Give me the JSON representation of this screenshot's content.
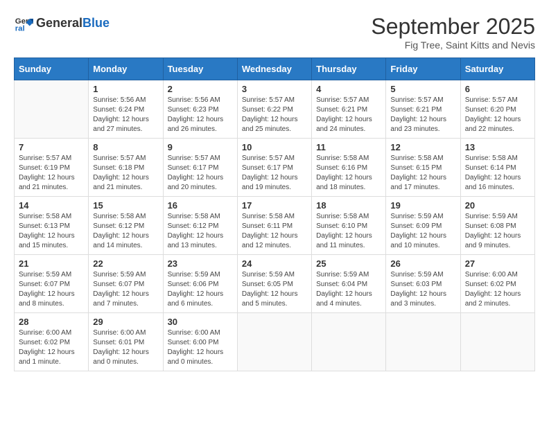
{
  "header": {
    "logo_general": "General",
    "logo_blue": "Blue",
    "month_title": "September 2025",
    "subtitle": "Fig Tree, Saint Kitts and Nevis"
  },
  "weekdays": [
    "Sunday",
    "Monday",
    "Tuesday",
    "Wednesday",
    "Thursday",
    "Friday",
    "Saturday"
  ],
  "weeks": [
    [
      {
        "day": "",
        "info": ""
      },
      {
        "day": "1",
        "info": "Sunrise: 5:56 AM\nSunset: 6:24 PM\nDaylight: 12 hours\nand 27 minutes."
      },
      {
        "day": "2",
        "info": "Sunrise: 5:56 AM\nSunset: 6:23 PM\nDaylight: 12 hours\nand 26 minutes."
      },
      {
        "day": "3",
        "info": "Sunrise: 5:57 AM\nSunset: 6:22 PM\nDaylight: 12 hours\nand 25 minutes."
      },
      {
        "day": "4",
        "info": "Sunrise: 5:57 AM\nSunset: 6:21 PM\nDaylight: 12 hours\nand 24 minutes."
      },
      {
        "day": "5",
        "info": "Sunrise: 5:57 AM\nSunset: 6:21 PM\nDaylight: 12 hours\nand 23 minutes."
      },
      {
        "day": "6",
        "info": "Sunrise: 5:57 AM\nSunset: 6:20 PM\nDaylight: 12 hours\nand 22 minutes."
      }
    ],
    [
      {
        "day": "7",
        "info": "Sunrise: 5:57 AM\nSunset: 6:19 PM\nDaylight: 12 hours\nand 21 minutes."
      },
      {
        "day": "8",
        "info": "Sunrise: 5:57 AM\nSunset: 6:18 PM\nDaylight: 12 hours\nand 21 minutes."
      },
      {
        "day": "9",
        "info": "Sunrise: 5:57 AM\nSunset: 6:17 PM\nDaylight: 12 hours\nand 20 minutes."
      },
      {
        "day": "10",
        "info": "Sunrise: 5:57 AM\nSunset: 6:17 PM\nDaylight: 12 hours\nand 19 minutes."
      },
      {
        "day": "11",
        "info": "Sunrise: 5:58 AM\nSunset: 6:16 PM\nDaylight: 12 hours\nand 18 minutes."
      },
      {
        "day": "12",
        "info": "Sunrise: 5:58 AM\nSunset: 6:15 PM\nDaylight: 12 hours\nand 17 minutes."
      },
      {
        "day": "13",
        "info": "Sunrise: 5:58 AM\nSunset: 6:14 PM\nDaylight: 12 hours\nand 16 minutes."
      }
    ],
    [
      {
        "day": "14",
        "info": "Sunrise: 5:58 AM\nSunset: 6:13 PM\nDaylight: 12 hours\nand 15 minutes."
      },
      {
        "day": "15",
        "info": "Sunrise: 5:58 AM\nSunset: 6:12 PM\nDaylight: 12 hours\nand 14 minutes."
      },
      {
        "day": "16",
        "info": "Sunrise: 5:58 AM\nSunset: 6:12 PM\nDaylight: 12 hours\nand 13 minutes."
      },
      {
        "day": "17",
        "info": "Sunrise: 5:58 AM\nSunset: 6:11 PM\nDaylight: 12 hours\nand 12 minutes."
      },
      {
        "day": "18",
        "info": "Sunrise: 5:58 AM\nSunset: 6:10 PM\nDaylight: 12 hours\nand 11 minutes."
      },
      {
        "day": "19",
        "info": "Sunrise: 5:59 AM\nSunset: 6:09 PM\nDaylight: 12 hours\nand 10 minutes."
      },
      {
        "day": "20",
        "info": "Sunrise: 5:59 AM\nSunset: 6:08 PM\nDaylight: 12 hours\nand 9 minutes."
      }
    ],
    [
      {
        "day": "21",
        "info": "Sunrise: 5:59 AM\nSunset: 6:07 PM\nDaylight: 12 hours\nand 8 minutes."
      },
      {
        "day": "22",
        "info": "Sunrise: 5:59 AM\nSunset: 6:07 PM\nDaylight: 12 hours\nand 7 minutes."
      },
      {
        "day": "23",
        "info": "Sunrise: 5:59 AM\nSunset: 6:06 PM\nDaylight: 12 hours\nand 6 minutes."
      },
      {
        "day": "24",
        "info": "Sunrise: 5:59 AM\nSunset: 6:05 PM\nDaylight: 12 hours\nand 5 minutes."
      },
      {
        "day": "25",
        "info": "Sunrise: 5:59 AM\nSunset: 6:04 PM\nDaylight: 12 hours\nand 4 minutes."
      },
      {
        "day": "26",
        "info": "Sunrise: 5:59 AM\nSunset: 6:03 PM\nDaylight: 12 hours\nand 3 minutes."
      },
      {
        "day": "27",
        "info": "Sunrise: 6:00 AM\nSunset: 6:02 PM\nDaylight: 12 hours\nand 2 minutes."
      }
    ],
    [
      {
        "day": "28",
        "info": "Sunrise: 6:00 AM\nSunset: 6:02 PM\nDaylight: 12 hours\nand 1 minute."
      },
      {
        "day": "29",
        "info": "Sunrise: 6:00 AM\nSunset: 6:01 PM\nDaylight: 12 hours\nand 0 minutes."
      },
      {
        "day": "30",
        "info": "Sunrise: 6:00 AM\nSunset: 6:00 PM\nDaylight: 12 hours\nand 0 minutes."
      },
      {
        "day": "",
        "info": ""
      },
      {
        "day": "",
        "info": ""
      },
      {
        "day": "",
        "info": ""
      },
      {
        "day": "",
        "info": ""
      }
    ]
  ]
}
